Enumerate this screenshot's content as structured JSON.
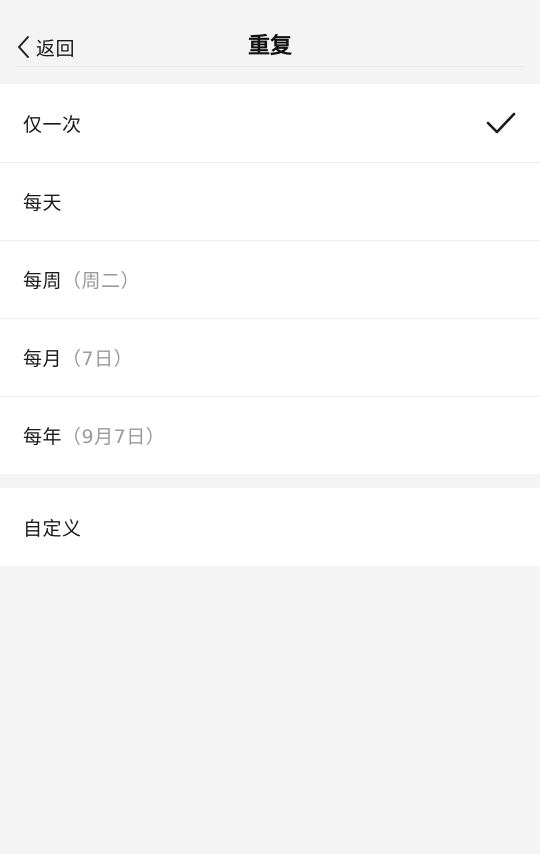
{
  "header": {
    "back_label": "返回",
    "title": "重复"
  },
  "options": [
    {
      "label": "仅一次",
      "sub": "",
      "selected": true
    },
    {
      "label": "每天",
      "sub": "",
      "selected": false
    },
    {
      "label": "每周",
      "sub": "（周二）",
      "selected": false
    },
    {
      "label": "每月",
      "sub": "（7日）",
      "selected": false
    },
    {
      "label": "每年",
      "sub": "（9月7日）",
      "selected": false
    }
  ],
  "custom": {
    "label": "自定义"
  },
  "colors": {
    "background": "#f4f4f4",
    "card": "#ffffff",
    "text": "#1a1a1a",
    "secondary_text": "#9a9a9a"
  },
  "icons": {
    "back": "chevron-left-icon",
    "selected": "checkmark-icon"
  }
}
